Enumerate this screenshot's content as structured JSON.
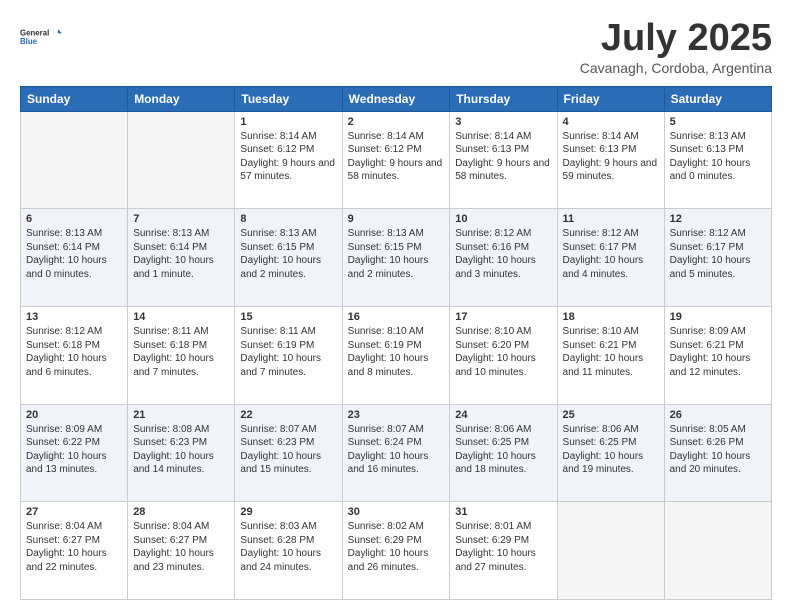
{
  "logo": {
    "general": "General",
    "blue": "Blue"
  },
  "title": "July 2025",
  "location": "Cavanagh, Cordoba, Argentina",
  "days_of_week": [
    "Sunday",
    "Monday",
    "Tuesday",
    "Wednesday",
    "Thursday",
    "Friday",
    "Saturday"
  ],
  "weeks": [
    [
      {
        "day": "",
        "info": ""
      },
      {
        "day": "",
        "info": ""
      },
      {
        "day": "1",
        "info": "Sunrise: 8:14 AM\nSunset: 6:12 PM\nDaylight: 9 hours and 57 minutes."
      },
      {
        "day": "2",
        "info": "Sunrise: 8:14 AM\nSunset: 6:12 PM\nDaylight: 9 hours and 58 minutes."
      },
      {
        "day": "3",
        "info": "Sunrise: 8:14 AM\nSunset: 6:13 PM\nDaylight: 9 hours and 58 minutes."
      },
      {
        "day": "4",
        "info": "Sunrise: 8:14 AM\nSunset: 6:13 PM\nDaylight: 9 hours and 59 minutes."
      },
      {
        "day": "5",
        "info": "Sunrise: 8:13 AM\nSunset: 6:13 PM\nDaylight: 10 hours and 0 minutes."
      }
    ],
    [
      {
        "day": "6",
        "info": "Sunrise: 8:13 AM\nSunset: 6:14 PM\nDaylight: 10 hours and 0 minutes."
      },
      {
        "day": "7",
        "info": "Sunrise: 8:13 AM\nSunset: 6:14 PM\nDaylight: 10 hours and 1 minute."
      },
      {
        "day": "8",
        "info": "Sunrise: 8:13 AM\nSunset: 6:15 PM\nDaylight: 10 hours and 2 minutes."
      },
      {
        "day": "9",
        "info": "Sunrise: 8:13 AM\nSunset: 6:15 PM\nDaylight: 10 hours and 2 minutes."
      },
      {
        "day": "10",
        "info": "Sunrise: 8:12 AM\nSunset: 6:16 PM\nDaylight: 10 hours and 3 minutes."
      },
      {
        "day": "11",
        "info": "Sunrise: 8:12 AM\nSunset: 6:17 PM\nDaylight: 10 hours and 4 minutes."
      },
      {
        "day": "12",
        "info": "Sunrise: 8:12 AM\nSunset: 6:17 PM\nDaylight: 10 hours and 5 minutes."
      }
    ],
    [
      {
        "day": "13",
        "info": "Sunrise: 8:12 AM\nSunset: 6:18 PM\nDaylight: 10 hours and 6 minutes."
      },
      {
        "day": "14",
        "info": "Sunrise: 8:11 AM\nSunset: 6:18 PM\nDaylight: 10 hours and 7 minutes."
      },
      {
        "day": "15",
        "info": "Sunrise: 8:11 AM\nSunset: 6:19 PM\nDaylight: 10 hours and 7 minutes."
      },
      {
        "day": "16",
        "info": "Sunrise: 8:10 AM\nSunset: 6:19 PM\nDaylight: 10 hours and 8 minutes."
      },
      {
        "day": "17",
        "info": "Sunrise: 8:10 AM\nSunset: 6:20 PM\nDaylight: 10 hours and 10 minutes."
      },
      {
        "day": "18",
        "info": "Sunrise: 8:10 AM\nSunset: 6:21 PM\nDaylight: 10 hours and 11 minutes."
      },
      {
        "day": "19",
        "info": "Sunrise: 8:09 AM\nSunset: 6:21 PM\nDaylight: 10 hours and 12 minutes."
      }
    ],
    [
      {
        "day": "20",
        "info": "Sunrise: 8:09 AM\nSunset: 6:22 PM\nDaylight: 10 hours and 13 minutes."
      },
      {
        "day": "21",
        "info": "Sunrise: 8:08 AM\nSunset: 6:23 PM\nDaylight: 10 hours and 14 minutes."
      },
      {
        "day": "22",
        "info": "Sunrise: 8:07 AM\nSunset: 6:23 PM\nDaylight: 10 hours and 15 minutes."
      },
      {
        "day": "23",
        "info": "Sunrise: 8:07 AM\nSunset: 6:24 PM\nDaylight: 10 hours and 16 minutes."
      },
      {
        "day": "24",
        "info": "Sunrise: 8:06 AM\nSunset: 6:25 PM\nDaylight: 10 hours and 18 minutes."
      },
      {
        "day": "25",
        "info": "Sunrise: 8:06 AM\nSunset: 6:25 PM\nDaylight: 10 hours and 19 minutes."
      },
      {
        "day": "26",
        "info": "Sunrise: 8:05 AM\nSunset: 6:26 PM\nDaylight: 10 hours and 20 minutes."
      }
    ],
    [
      {
        "day": "27",
        "info": "Sunrise: 8:04 AM\nSunset: 6:27 PM\nDaylight: 10 hours and 22 minutes."
      },
      {
        "day": "28",
        "info": "Sunrise: 8:04 AM\nSunset: 6:27 PM\nDaylight: 10 hours and 23 minutes."
      },
      {
        "day": "29",
        "info": "Sunrise: 8:03 AM\nSunset: 6:28 PM\nDaylight: 10 hours and 24 minutes."
      },
      {
        "day": "30",
        "info": "Sunrise: 8:02 AM\nSunset: 6:29 PM\nDaylight: 10 hours and 26 minutes."
      },
      {
        "day": "31",
        "info": "Sunrise: 8:01 AM\nSunset: 6:29 PM\nDaylight: 10 hours and 27 minutes."
      },
      {
        "day": "",
        "info": ""
      },
      {
        "day": "",
        "info": ""
      }
    ]
  ]
}
